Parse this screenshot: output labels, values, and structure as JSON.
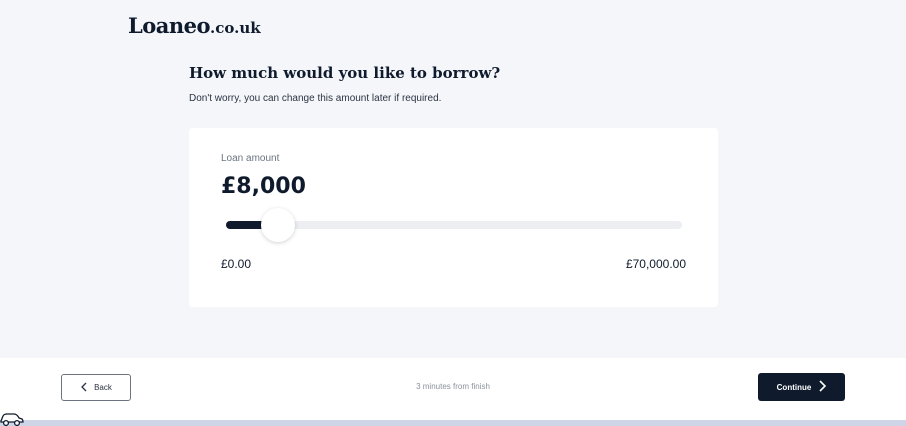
{
  "brand": {
    "name": "Loaneo",
    "tld": ".co.uk"
  },
  "question": {
    "title": "How much would you like to borrow?",
    "subtitle": "Don't worry, you can change this amount later if required."
  },
  "loan": {
    "label": "Loan amount",
    "value_display": "£8,000",
    "value": 8000,
    "min": 0,
    "max": 70000,
    "min_display": "£0.00",
    "max_display": "£70,000.00"
  },
  "footer": {
    "back_label": "Back",
    "progress_text": "3 minutes from finish",
    "continue_label": "Continue"
  },
  "icons": {
    "back": "chevron-left-icon",
    "continue": "chevron-right-icon",
    "progress": "car-icon"
  },
  "colors": {
    "primary": "#0f1b2d",
    "background": "#f4f6fa",
    "progress_track": "#cdd5e6"
  }
}
